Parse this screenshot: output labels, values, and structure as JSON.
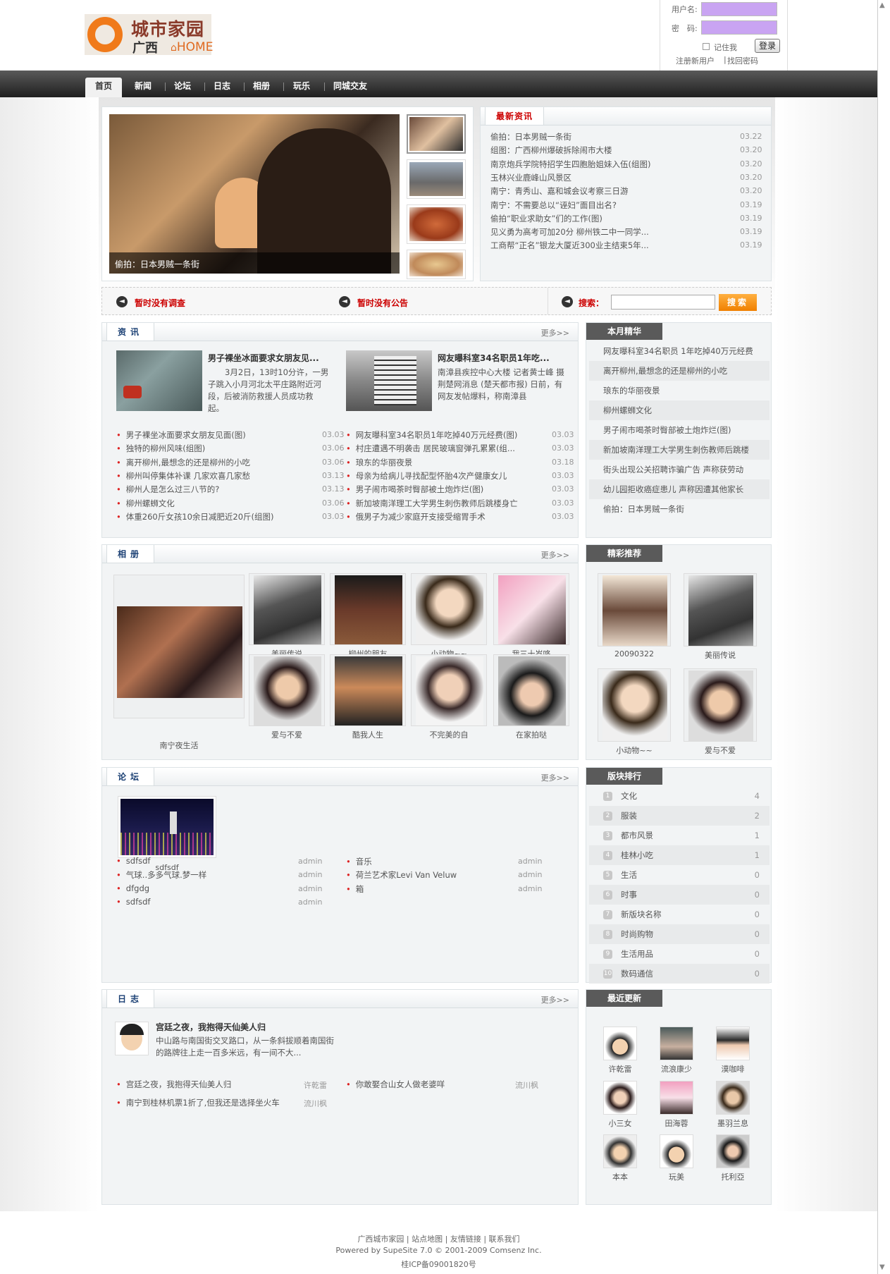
{
  "login": {
    "username_label": "用户名:",
    "password_label": "密　码:",
    "remember_label": "记住我",
    "login_button": "登录",
    "register_link": "注册新用户",
    "forgot_link": "找回密码",
    "divider": "|"
  },
  "logo": {
    "title": "城市家园",
    "region": "广西",
    "home": "HOME"
  },
  "nav": [
    "首页",
    "新闻",
    "论坛",
    "日志",
    "相册",
    "玩乐",
    "同城交友"
  ],
  "hero": {
    "caption": "偷拍：日本男贼一条街"
  },
  "latest": {
    "title": "最新资讯",
    "items": [
      {
        "t": "偷拍：日本男贼一条街",
        "d": "03.22"
      },
      {
        "t": "组图：广西柳州爆破拆除闹市大楼",
        "d": "03.20"
      },
      {
        "t": "南京炮兵学院特招学生四胞胎姐妹入伍(组图)",
        "d": "03.20"
      },
      {
        "t": "玉林兴业鹿峰山风景区",
        "d": "03.20"
      },
      {
        "t": "南宁：青秀山、嘉和城会议考察三日游",
        "d": "03.20"
      },
      {
        "t": "南宁：不需要总以“诬妇”面目出名?",
        "d": "03.19"
      },
      {
        "t": "偷拍“职业求助女”们的工作(图)",
        "d": "03.19"
      },
      {
        "t": "见义勇为高考可加20分 柳州铁二中一同学...",
        "d": "03.19"
      },
      {
        "t": "工商帮“正名”银龙大厦近300业主结束5年...",
        "d": "03.19"
      }
    ]
  },
  "bar": {
    "survey": "暂时没有调查",
    "notice": "暂时没有公告",
    "search_label": "搜索：",
    "search_button": "搜索"
  },
  "news": {
    "title": "资讯",
    "more": "更多>>",
    "feat1": {
      "title": "男子裸坐冰面要求女朋友见...",
      "text": "3月2日，13时10分许，一男子跳入小月河北太平庄路附近河段，后被消防救援人员成功救起。"
    },
    "feat2": {
      "title": "网友曝科室34名职员1年吃...",
      "text": "南漳县疾控中心大楼 记者黄士峰 摄　荆楚网消息 (楚天都市报) 日前，有网友发帖爆料，称南漳县"
    },
    "left": [
      {
        "t": "男子裸坐冰面要求女朋友见面(图)",
        "d": "03.03"
      },
      {
        "t": "独特的柳州风味(组图)",
        "d": "03.06"
      },
      {
        "t": "离开柳州,最想念的还是柳州的小吃",
        "d": "03.06"
      },
      {
        "t": "柳州叫停集体补课 几家欢喜几家愁",
        "d": "03.13"
      },
      {
        "t": "柳州人是怎么过三八节的?",
        "d": "03.13"
      },
      {
        "t": "柳州螺蛳文化",
        "d": "03.06"
      },
      {
        "t": "体重260斤女孩10余日减肥近20斤(组图)",
        "d": "03.03"
      }
    ],
    "right": [
      {
        "t": "网友曝科室34名职员1年吃掉40万元经费(图)",
        "d": "03.03"
      },
      {
        "t": "村庄遭遇不明袭击 居民玻璃窗弹孔累累(组...",
        "d": "03.03"
      },
      {
        "t": "琅东的华丽夜景",
        "d": "03.18"
      },
      {
        "t": "母亲为给病儿寻找配型怀胎4次产健康女儿",
        "d": "03.03"
      },
      {
        "t": "男子闹市喝茶时臀部被土炮炸烂(图)",
        "d": "03.03"
      },
      {
        "t": "新加坡南洋理工大学男生刺伤教师后跳楼身亡",
        "d": "03.03"
      },
      {
        "t": "俄男子为减少家庭开支接受缩胃手术",
        "d": "03.03"
      }
    ]
  },
  "monthly": {
    "title": "本月精华",
    "items": [
      "网友曝科室34名职员 1年吃掉40万元经费",
      "离开柳州,最想念的还是柳州的小吃",
      "琅东的华丽夜景",
      "柳州螺蛳文化",
      "男子闹市喝茶时臀部被土炮炸烂(图)",
      "新加坡南洋理工大学男生刺伤教师后跳楼",
      "街头出现公关招聘诈骗广告 声称获劳动",
      "幼儿园拒收癌症患儿 声称因遭其他家长",
      "偷拍：日本男贼一条街"
    ]
  },
  "album": {
    "title": "相册",
    "more": "更多>>",
    "big": "南宁夜生活",
    "items": [
      "美丽传说",
      "柳州的朋友",
      "小动物~~",
      "我三十岁咯",
      "爱与不爱",
      "酷我人生",
      "不完美的自",
      "在家拍哒"
    ]
  },
  "picks": {
    "title": "精彩推荐",
    "items": [
      "20090322",
      "美丽传说",
      "小动物~~",
      "爱与不爱"
    ]
  },
  "forum": {
    "title": "论坛",
    "more": "更多>>",
    "img_caption": "sdfsdf",
    "left": [
      {
        "t": "sdfsdf",
        "a": "admin"
      },
      {
        "t": "气球..多多气球.梦一样",
        "a": "admin"
      },
      {
        "t": "dfgdg",
        "a": "admin"
      },
      {
        "t": "sdfsdf",
        "a": "admin"
      }
    ],
    "right": [
      {
        "t": "音乐",
        "a": "admin"
      },
      {
        "t": "荷兰艺术家Levi Van Veluw",
        "a": "admin"
      },
      {
        "t": "箱",
        "a": "admin"
      }
    ]
  },
  "ranking": {
    "title": "版块排行",
    "items": [
      {
        "n": "文化",
        "c": "4"
      },
      {
        "n": "服装",
        "c": "2"
      },
      {
        "n": "都市风景",
        "c": "1"
      },
      {
        "n": "桂林小吃",
        "c": "1"
      },
      {
        "n": "生活",
        "c": "0"
      },
      {
        "n": "时事",
        "c": "0"
      },
      {
        "n": "新版块名称",
        "c": "0"
      },
      {
        "n": "时尚购物",
        "c": "0"
      },
      {
        "n": "生活用品",
        "c": "0"
      },
      {
        "n": "数码通信",
        "c": "0"
      }
    ]
  },
  "blog": {
    "title": "日志",
    "more": "更多>>",
    "feat": {
      "title": "宫廷之夜，我抱得天仙美人归",
      "text": "中山路与南国街交叉路口，从一条斜拔顺着南国街的路牌往上走一百多米远，有一间不大..."
    },
    "left": [
      {
        "t": "宫廷之夜，我抱得天仙美人归",
        "a": "许乾雷"
      },
      {
        "t": "南宁到桂林机票1折了,但我还是选择坐火车",
        "a": "流川枫"
      }
    ],
    "right": [
      {
        "t": "你敢娶合山女人做老婆咩",
        "a": "流川枫"
      }
    ]
  },
  "recent": {
    "title": "最近更新",
    "items": [
      "许乾雷",
      "流浪康少",
      "漠咖啡",
      "小三女",
      "田海蓉",
      "墨羽兰息",
      "本本",
      "玩美",
      "托利亞"
    ]
  },
  "footer": {
    "links": "广西城市家园 | 站点地图 | 友情链接 | 联系我们",
    "powered": "Powered by SupeSite 7.0 © 2001-2009 Comsenz Inc.",
    "icp": "桂ICP备09001820号"
  }
}
